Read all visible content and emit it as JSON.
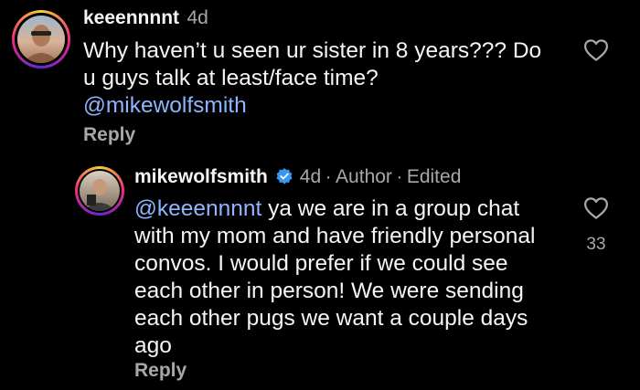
{
  "colors": {
    "background": "#000000",
    "text": "#f5f5f5",
    "muted": "#a8a8a8",
    "mention": "#8eb5ff",
    "verified": "#3897f0"
  },
  "comments": [
    {
      "username": "keeennnnt",
      "time": "4d",
      "text_lines": [
        "Why haven’t u seen ur sister in 8 years??? Do",
        "u guys talk at least/face time?"
      ],
      "mention_line": "@mikewolfsmith",
      "reply_label": "Reply",
      "like_icon": "heart-outline-icon"
    },
    {
      "username": "mikewolfsmith",
      "verified_icon": "verified-badge-icon",
      "time": "4d",
      "separator": "·",
      "author_label": "Author",
      "edited_label": "Edited",
      "mention": "@keeennnnt",
      "first_line_rest": " ya we are in a group chat",
      "text_lines": [
        "with my mom and have friendly personal",
        "convos.  I would prefer if we could see",
        "each other in person!  We were sending",
        "each other pugs we want a couple days",
        "ago"
      ],
      "reply_label": "Reply",
      "like_icon": "heart-outline-icon",
      "like_count": "33"
    }
  ]
}
